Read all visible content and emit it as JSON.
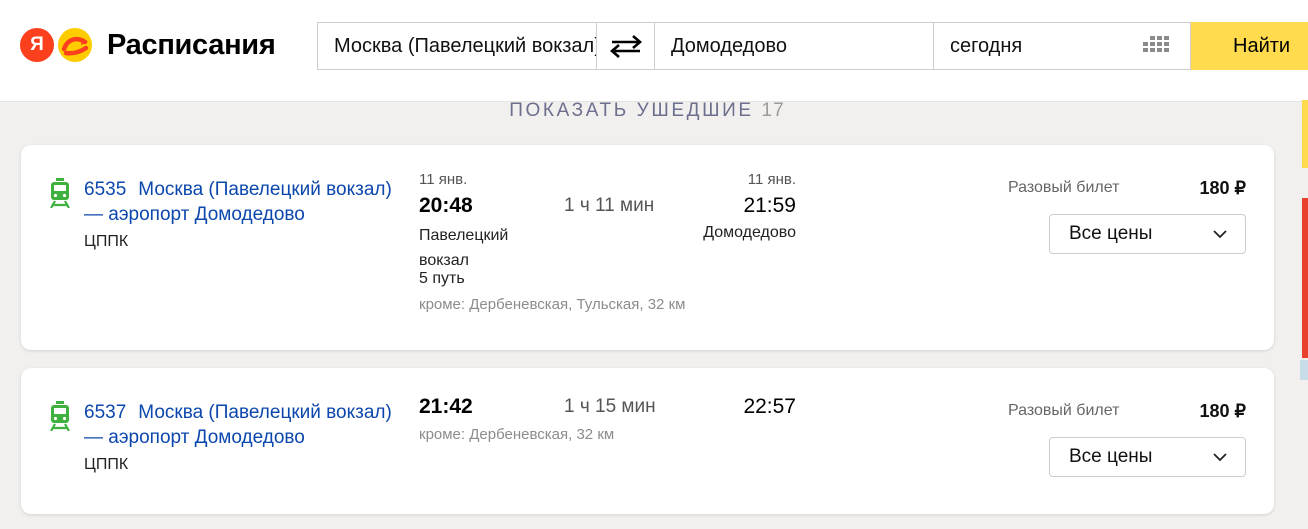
{
  "header": {
    "logo_letter": "Я",
    "brand": "Расписания",
    "search": {
      "from": "Москва (Павелецкий вокзал)",
      "to": "Домодедово",
      "date": "сегодня",
      "submit": "Найти"
    }
  },
  "show_departed": {
    "label": "ПОКАЗАТЬ УШЕДШИЕ",
    "count": "17"
  },
  "trips": [
    {
      "number": "6535",
      "title": "Москва (Павелецкий вокзал) — аэропорт Домодедово",
      "carrier": "ЦППК",
      "departure": {
        "date": "11 янв.",
        "time": "20:48",
        "station": "Павелецкий вокзал",
        "platform": "5 путь"
      },
      "duration": "1 ч 11 мин",
      "arrival": {
        "date": "11 янв.",
        "time": "21:59",
        "station": "Домодедово"
      },
      "except": "кроме: Дербеневская, Тульская, 32 км",
      "ticket_label": "Разовый билет",
      "price": "180 ₽",
      "prices_button": "Все цены"
    },
    {
      "number": "6537",
      "title": "Москва (Павелецкий вокзал) — аэропорт Домодедово",
      "carrier": "ЦППК",
      "departure": {
        "time": "21:42"
      },
      "duration": "1 ч 15 мин",
      "arrival": {
        "time": "22:57"
      },
      "except": "кроме: Дербеневская, 32 км",
      "ticket_label": "Разовый билет",
      "price": "180 ₽",
      "prices_button": "Все цены"
    }
  ],
  "icons": {
    "train": "suburban-train-icon",
    "swap": "swap-arrows-icon",
    "calendar": "calendar-icon",
    "chevron": "chevron-down-icon"
  },
  "colors": {
    "link": "#0c47ad",
    "accent_yellow": "#ffdb4d",
    "brand_red": "#fc3f1d",
    "train_green": "#3fb13f",
    "background": "#f1f0ee"
  }
}
